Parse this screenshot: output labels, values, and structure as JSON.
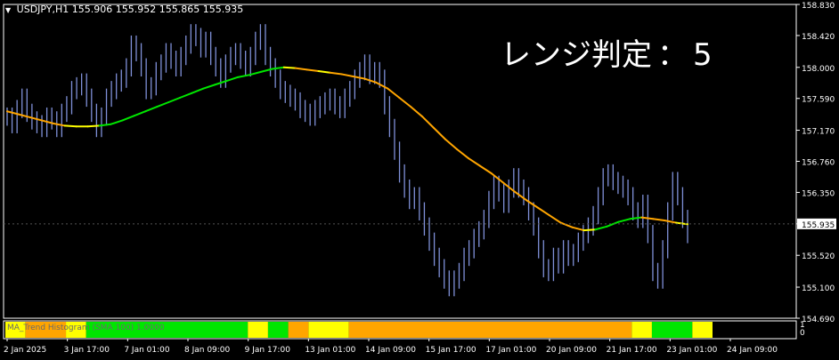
{
  "header": {
    "symbol": "USDJPY,H1",
    "ohlc": [
      "155.906",
      "155.952",
      "155.865",
      "155.935"
    ]
  },
  "annotation": {
    "label": "レンジ判定",
    "separator": "：",
    "value": "5"
  },
  "indicator": {
    "label": "MA_Trend Histogram (SMA 100) 1.0000",
    "scale_top": "1",
    "scale_bottom": "0"
  },
  "colors": {
    "background": "#000000",
    "grid_frame": "#ffffff",
    "price": "#7f90d8",
    "ma_up": "#00e600",
    "ma_flat": "#ffff00",
    "ma_down": "#ffa500",
    "current_price_tag": "#ffffff"
  },
  "chart_data": {
    "type": "line",
    "title": "USDJPY,H1",
    "ylim": [
      154.69,
      158.83
    ],
    "y_ticks": [
      "158.830",
      "158.420",
      "158.000",
      "157.590",
      "157.170",
      "156.760",
      "156.350",
      "155.935",
      "155.520",
      "155.100",
      "154.690"
    ],
    "x_ticks": [
      "2 Jan 2025",
      "3 Jan 17:00",
      "7 Jan 01:00",
      "8 Jan 09:00",
      "9 Jan 17:00",
      "13 Jan 01:00",
      "14 Jan 09:00",
      "15 Jan 17:00",
      "17 Jan 01:00",
      "20 Jan 09:00",
      "21 Jan 17:00",
      "23 Jan 01:00",
      "24 Jan 09:00"
    ],
    "current_price": 155.935,
    "series": [
      {
        "values": [
          157.35,
          157.25,
          157.45,
          157.6,
          157.4,
          157.3,
          157.25,
          157.2,
          157.35,
          157.3,
          157.2,
          157.4,
          157.5,
          157.7,
          157.75,
          157.8,
          157.6,
          157.4,
          157.2,
          157.35,
          157.6,
          157.7,
          157.8,
          157.85,
          158.0,
          158.3,
          158.2,
          158.0,
          157.7,
          157.75,
          157.95,
          158.05,
          158.2,
          158.1,
          158.0,
          158.15,
          158.3,
          158.45,
          158.4,
          158.25,
          158.35,
          158.15,
          158.0,
          157.85,
          158.05,
          158.15,
          158.2,
          158.1,
          158.0,
          158.15,
          158.35,
          158.45,
          158.15,
          158.0,
          157.85,
          157.7,
          157.65,
          157.6,
          157.55,
          157.45,
          157.4,
          157.35,
          157.45,
          157.5,
          157.55,
          157.6,
          157.5,
          157.45,
          157.6,
          157.7,
          157.85,
          157.95,
          158.05,
          157.9,
          157.95,
          157.85,
          157.5,
          157.2,
          156.9,
          156.6,
          156.4,
          156.25,
          156.3,
          156.1,
          155.9,
          155.7,
          155.5,
          155.35,
          155.2,
          155.1,
          155.2,
          155.3,
          155.5,
          155.6,
          155.75,
          155.85,
          156.0,
          156.25,
          156.45,
          156.35,
          156.2,
          156.4,
          156.55,
          156.4,
          156.3,
          156.1,
          155.9,
          155.6,
          155.35,
          155.3,
          155.5,
          155.4,
          155.6,
          155.5,
          155.55,
          155.7,
          155.8,
          155.9,
          156.05,
          156.3,
          156.55,
          156.6,
          156.5,
          156.45,
          156.4,
          156.3,
          156.1,
          156.0,
          156.2,
          155.8,
          155.3,
          155.2,
          155.6,
          156.1,
          156.5,
          156.3,
          156.0,
          155.8
        ],
        "color": "#7f90d8"
      },
      {
        "values": [
          157.42,
          157.38,
          157.34,
          157.3,
          157.26,
          157.23,
          157.22,
          157.22,
          157.23,
          157.25,
          157.3,
          157.36,
          157.42,
          157.48,
          157.54,
          157.6,
          157.66,
          157.72,
          157.77,
          157.82,
          157.87,
          157.9,
          157.94,
          157.98,
          158.0,
          157.99,
          157.97,
          157.95,
          157.93,
          157.91,
          157.88,
          157.85,
          157.8,
          157.72,
          157.6,
          157.48,
          157.35,
          157.2,
          157.05,
          156.92,
          156.8,
          156.7,
          156.6,
          156.48,
          156.36,
          156.25,
          156.15,
          156.05,
          155.95,
          155.89,
          155.85,
          155.86,
          155.9,
          155.96,
          156.0,
          156.02,
          156.0,
          155.98,
          155.95,
          155.93
        ],
        "color": "#ffa500"
      }
    ],
    "histogram": [
      {
        "state": "yellow",
        "span": 1
      },
      {
        "state": "orange",
        "span": 2
      },
      {
        "state": "yellow",
        "span": 1
      },
      {
        "state": "green",
        "span": 8
      },
      {
        "state": "yellow",
        "span": 1
      },
      {
        "state": "green",
        "span": 1
      },
      {
        "state": "orange",
        "span": 1
      },
      {
        "state": "yellow",
        "span": 2
      },
      {
        "state": "orange",
        "span": 14
      },
      {
        "state": "yellow",
        "span": 1
      },
      {
        "state": "green",
        "span": 2
      },
      {
        "state": "yellow",
        "span": 1
      }
    ]
  }
}
